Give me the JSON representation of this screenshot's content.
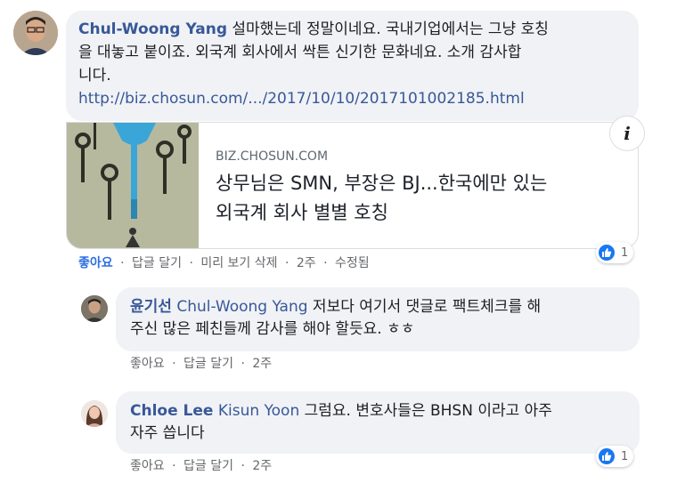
{
  "comment1": {
    "author": "Chul-Woong Yang",
    "text_line1": "설마했는데 정말이네요. 국내기업에서는 그냥 호칭",
    "text_line2": "을 대놓고 붙이죠. 외국계 회사에서 싹튼 신기한 문화네요. 소개 감사합",
    "text_line3": "니다.",
    "link": "http://biz.chosun.com/.../2017/10/10/2017101002185.html",
    "preview": {
      "domain": "BIZ.CHOSUN.COM",
      "title_line1": "상무님은 SMN, 부장은 BJ...한국에만 있는",
      "title_line2": "외국계 회사 별별 호칭",
      "info_icon": "i"
    },
    "actions": {
      "like": "좋아요",
      "reply": "답글 달기",
      "remove_preview": "미리 보기 삭제",
      "time": "2주",
      "edited": "수정됨"
    },
    "reaction_count": "1"
  },
  "reply1": {
    "author": "윤기선",
    "tag": "Chul-Woong Yang",
    "text_line1": " 저보다 여기서 댓글로 팩트체크를 해",
    "text_line2": "주신 많은 페친들께 감사를 해야 할듯요. ㅎㅎ",
    "actions": {
      "like": "좋아요",
      "reply": "답글 달기",
      "time": "2주"
    }
  },
  "reply2": {
    "author": "Chloe Lee",
    "tag": "Kisun Yoon",
    "text_line1": " 그럼요. 변호사들은 BHSN 이라고 아주",
    "text_line2": "자주 씁니다",
    "actions": {
      "like": "좋아요",
      "reply": "답글 달기",
      "time": "2주"
    },
    "reaction_count": "1"
  },
  "separator": "·",
  "colors": {
    "link": "#385898",
    "bubble": "#f0f2f5",
    "like": "#1877f2",
    "meta": "#65676b"
  }
}
